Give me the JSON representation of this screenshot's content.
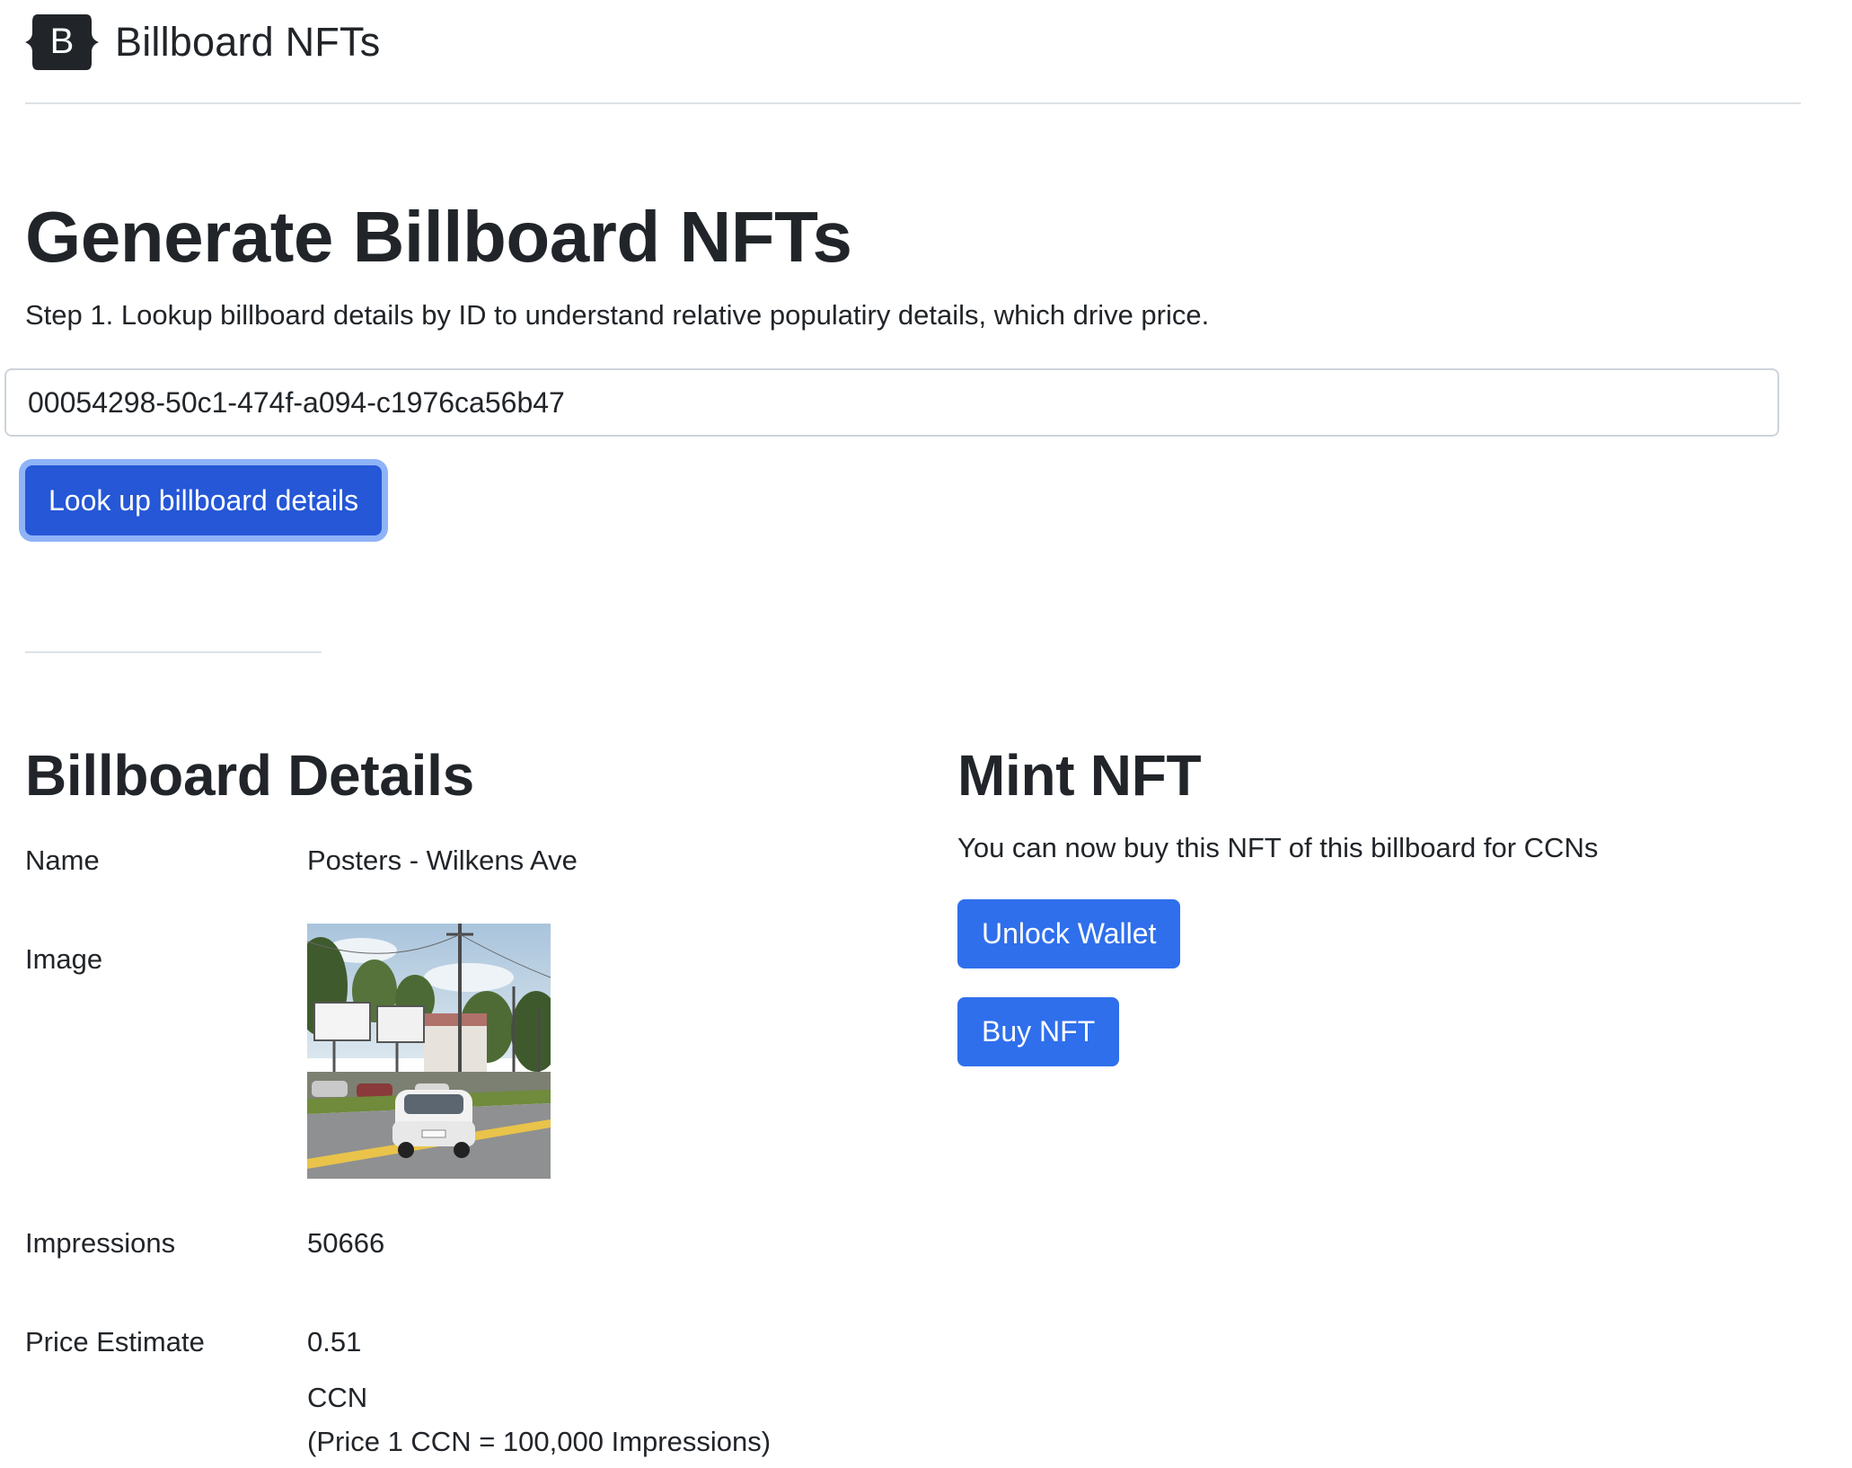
{
  "header": {
    "logo_letter": "B",
    "brand": "Billboard NFTs"
  },
  "hero": {
    "title": "Generate Billboard NFTs",
    "description": "Step 1. Lookup billboard details by ID to understand relative populatiry details, which drive price.",
    "billboard_id_value": "00054298-50c1-474f-a094-c1976ca56b47",
    "lookup_button_label": "Look up billboard details"
  },
  "details": {
    "title": "Billboard Details",
    "name_label": "Name",
    "name_value": "Posters - Wilkens Ave",
    "image_label": "Image",
    "impressions_label": "Impressions",
    "impressions_value": "50666",
    "price_label": "Price Estimate",
    "price_value": "0.51",
    "price_unit": "CCN",
    "price_note": "(Price 1 CCN = 100,000 Impressions)"
  },
  "mint": {
    "title": "Mint NFT",
    "description": "You can now buy this NFT of this billboard for CCNs",
    "unlock_button_label": "Unlock Wallet",
    "buy_button_label": "Buy NFT"
  },
  "colors": {
    "primary_button": "#2f6fec",
    "focused_button": "#2557d6",
    "focus_ring": "#8fb3f7",
    "text": "#212529",
    "rule": "#dee2e6"
  }
}
